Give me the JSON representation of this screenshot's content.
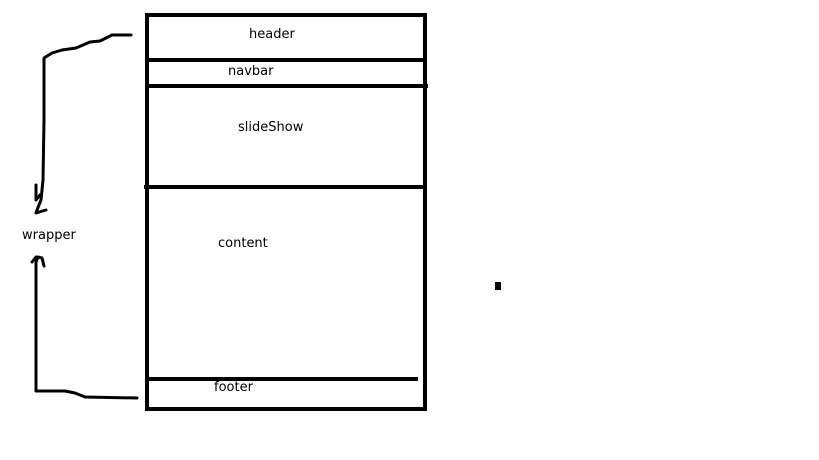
{
  "wrapper_label": "wrapper",
  "sections": [
    {
      "id": "header",
      "label": "header"
    },
    {
      "id": "navbar",
      "label": "navbar"
    },
    {
      "id": "slideshow",
      "label": "slideShow"
    },
    {
      "id": "content",
      "label": "content"
    },
    {
      "id": "footer",
      "label": "footer"
    }
  ],
  "colors": {
    "stroke": "#000000",
    "background": "#ffffff"
  }
}
